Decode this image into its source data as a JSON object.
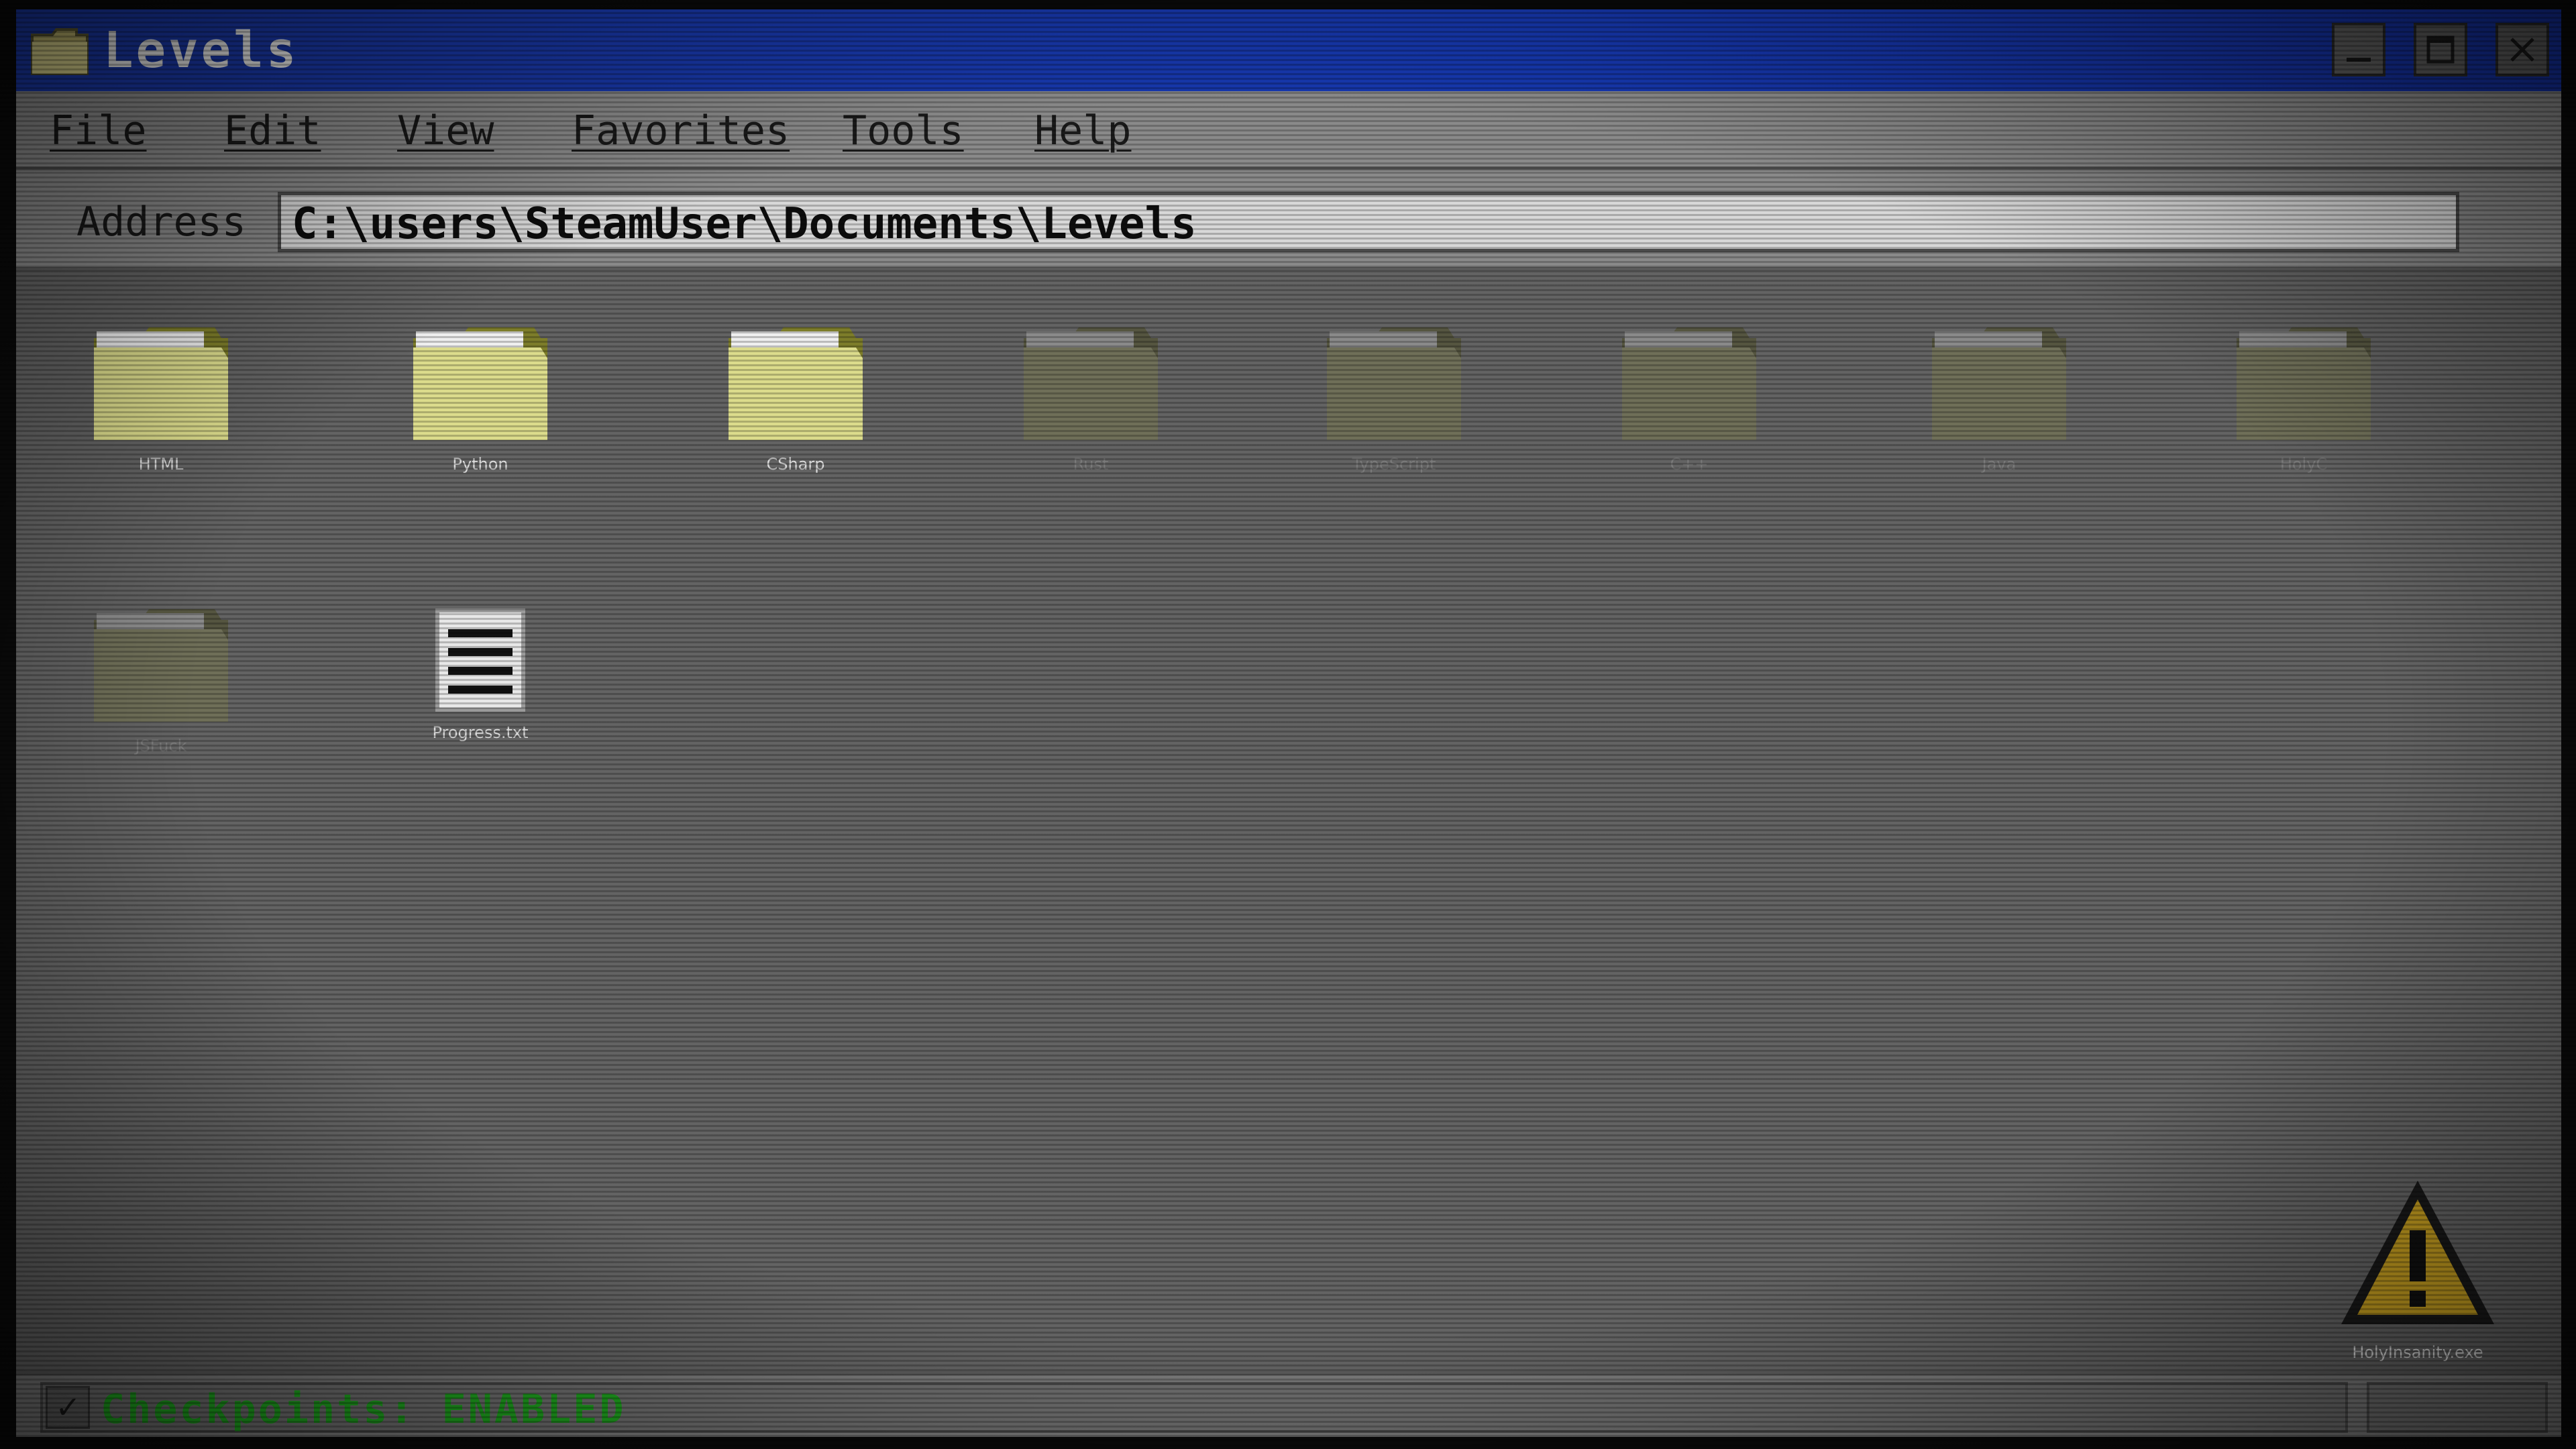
{
  "window": {
    "title": "Levels",
    "title_icon": "folder-icon",
    "controls": {
      "minimize": "minimize-icon",
      "maximize": "maximize-icon",
      "close": "close-icon"
    }
  },
  "menubar": {
    "items": [
      {
        "label": "File"
      },
      {
        "label": "Edit"
      },
      {
        "label": "View"
      },
      {
        "label": "Favorites"
      },
      {
        "label": "Tools"
      },
      {
        "label": "Help"
      }
    ]
  },
  "address": {
    "label": "Address",
    "value": "C:\\users\\SteamUser\\Documents\\Levels"
  },
  "items": [
    {
      "label": "HTML",
      "icon": "folder-icon",
      "locked": false
    },
    {
      "label": "Python",
      "icon": "folder-icon",
      "locked": false
    },
    {
      "label": "CSharp",
      "icon": "folder-icon",
      "locked": false
    },
    {
      "label": "Rust",
      "icon": "folder-icon",
      "locked": true
    },
    {
      "label": "TypeScript",
      "icon": "folder-icon",
      "locked": true
    },
    {
      "label": "C++",
      "icon": "folder-icon",
      "locked": true
    },
    {
      "label": "Java",
      "icon": "folder-icon",
      "locked": true
    },
    {
      "label": "HolyC",
      "icon": "folder-icon",
      "locked": true
    },
    {
      "label": "JSFuck",
      "icon": "folder-icon",
      "locked": true
    },
    {
      "label": "Progress.txt",
      "icon": "text-file-icon",
      "locked": false
    }
  ],
  "warning_file": {
    "label": "HolyInsanity.exe",
    "icon": "warning-icon"
  },
  "status": {
    "checkbox": "✓",
    "text": "Checkpoints: ENABLED",
    "color": "#1fa51f"
  },
  "colors": {
    "titlebar": "#1a38a6",
    "folder_active": "#dcdc8c",
    "folder_locked": "#6f6f58",
    "warning": "#c8a020"
  }
}
